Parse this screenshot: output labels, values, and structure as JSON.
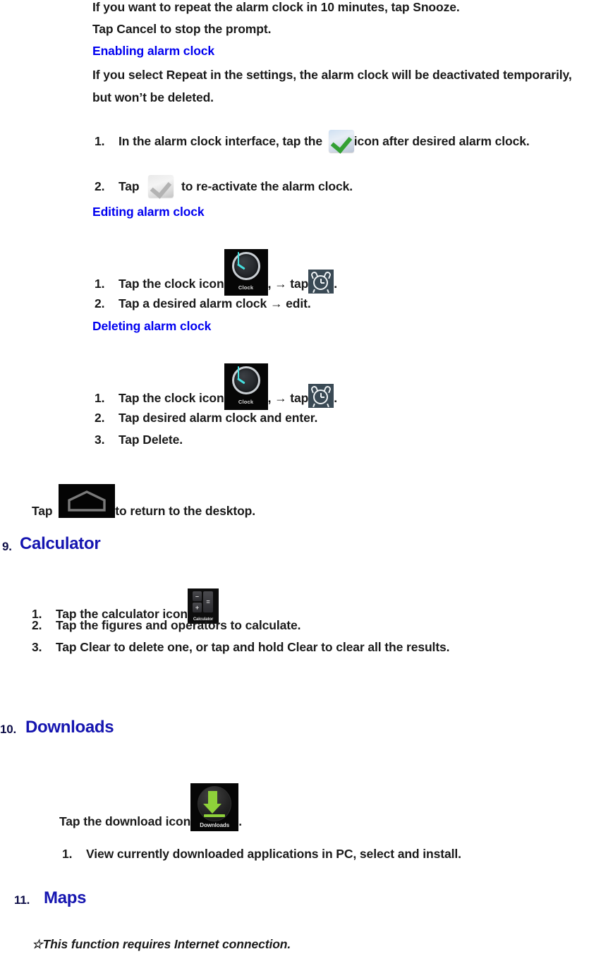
{
  "document": {
    "lines": {
      "snooze": "If you want to repeat the alarm clock in 10 minutes, tap Snooze.",
      "cancel": "Tap Cancel to stop the prompt.",
      "repeat_1": "If you select Repeat in the settings, the alarm clock will be deactivated temporarily,",
      "repeat_2": "but won’t be deleted."
    },
    "headings": {
      "enabling": "Enabling alarm clock",
      "editing": "Editing alarm clock",
      "deleting": "Deleting alarm clock"
    },
    "enabling_steps": [
      {
        "num": "1.",
        "before": "In the alarm clock interface, tap the ",
        "icon": "check-on-icon",
        "after": "icon after desired alarm clock."
      },
      {
        "num": "2.",
        "before": "Tap ",
        "icon": "check-off-icon",
        "after": " to re-activate the alarm clock."
      }
    ],
    "editing_steps": [
      {
        "num": "1.",
        "before": "Tap the clock icon",
        "icon_a": "clock-app-icon",
        "middle": ", → tap",
        "icon_b": "alarm-clock-icon",
        "after": "."
      },
      {
        "num": "2.",
        "text": "Tap a desired alarm clock → edit."
      }
    ],
    "deleting_steps": [
      {
        "num": "1.",
        "before": "Tap the clock icon",
        "icon_a": "clock-app-icon",
        "middle": ", → tap",
        "icon_b": "alarm-clock-icon",
        "after": "."
      },
      {
        "num": "2.",
        "text": "Tap desired alarm clock and enter."
      },
      {
        "num": "3.",
        "text": "Tap Delete."
      }
    ],
    "home_line": {
      "before": "Tap ",
      "icon": "home-key-icon",
      "after": "to return to the desktop."
    },
    "sections": [
      {
        "number": "9.",
        "title": "Calculator"
      },
      {
        "number": "10.",
        "title": "Downloads"
      },
      {
        "number": "11.",
        "title": "Maps"
      }
    ],
    "calculator_steps": [
      {
        "num": "1.",
        "before": "Tap the calculator icon",
        "icon": "calculator-app-icon",
        "after": ""
      },
      {
        "num": "2.",
        "text": "Tap the figures and operators to calculate."
      },
      {
        "num": "3.",
        "text": "Tap Clear to delete one, or tap and hold Clear to clear all the results."
      }
    ],
    "downloads_line": {
      "before": "Tap the download icon",
      "icon": "downloads-app-icon",
      "after": "."
    },
    "downloads_steps": [
      {
        "num": "1.",
        "text": "View currently downloaded applications in PC, select and install."
      }
    ],
    "maps_note": "☆This function requires Internet connection."
  },
  "icon_labels": {
    "clock": "Clock",
    "calculator": "Calculator",
    "downloads": "Downloads"
  },
  "calculator_keys": {
    "minus": "–",
    "plus": "+",
    "equals": "="
  },
  "colors": {
    "subheading_blue": "#0000f0",
    "section_title_blue": "#1515b0",
    "section_number_navy": "#0d0d47",
    "body_text": "#1a1a1a",
    "check_green": "#33a033",
    "downloads_green": "#8ed13a",
    "clock_hand_cyan": "#46e0e0",
    "alarm_bg": "#3a4a55"
  }
}
